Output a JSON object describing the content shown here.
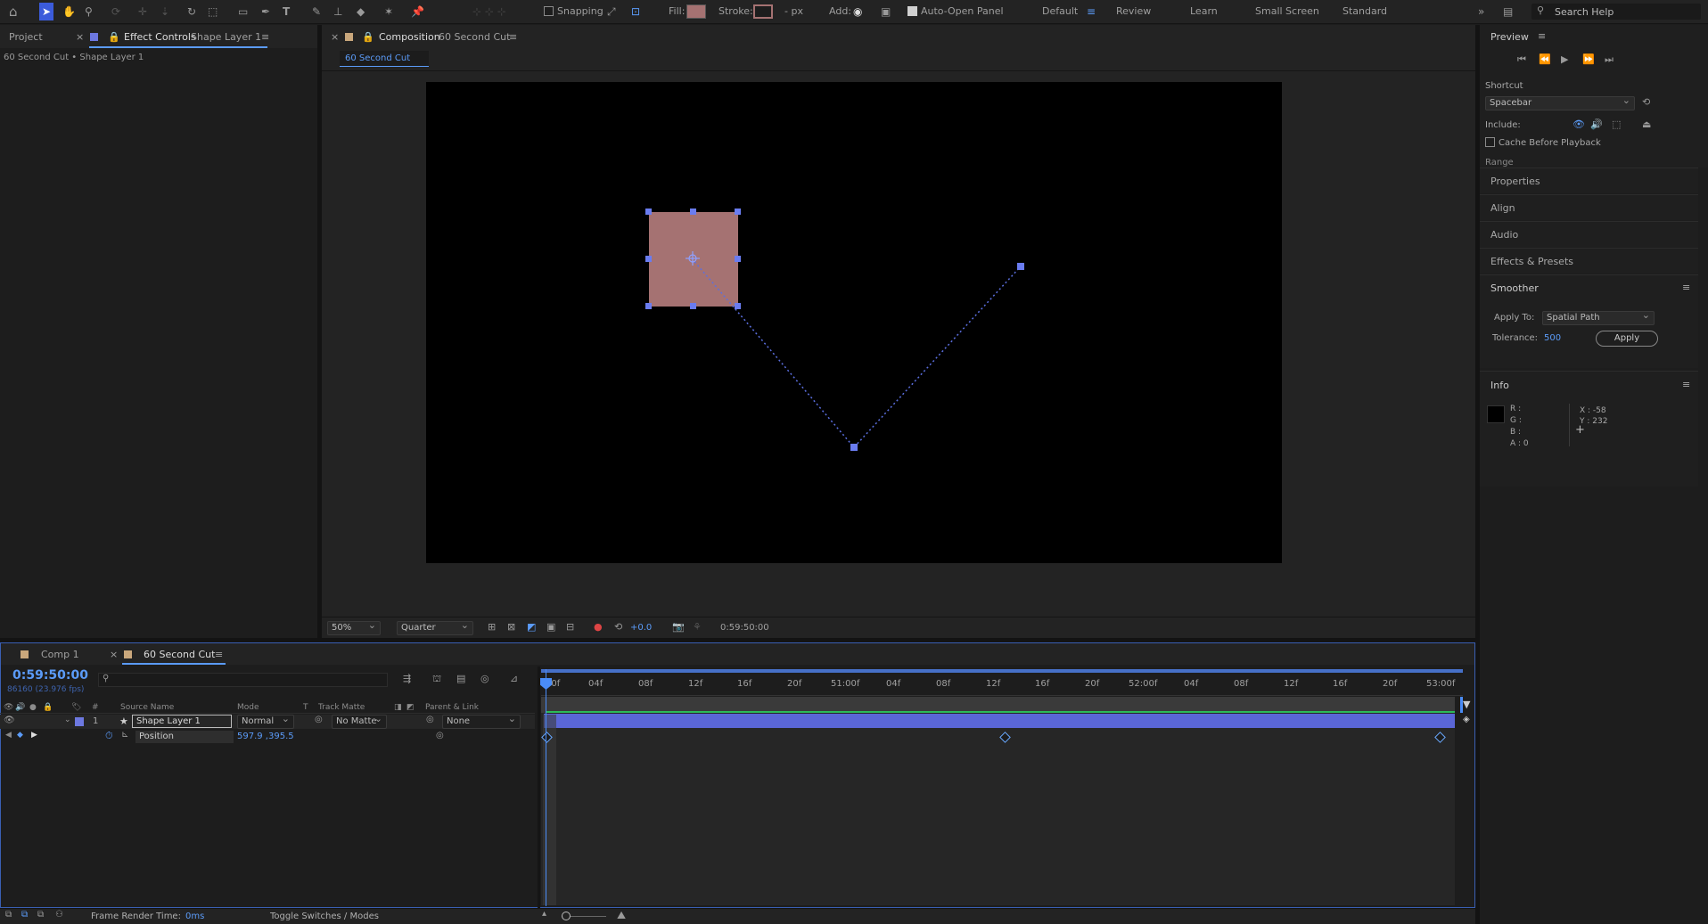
{
  "toolbar": {
    "snapping_label": "Snapping",
    "fill_label": "Fill:",
    "stroke_label": "Stroke:",
    "stroke_px_label": "- px",
    "add_label": "Add:",
    "auto_open_label": "Auto-Open Panel",
    "workspaces": [
      "Default",
      "Review",
      "Learn",
      "Small Screen",
      "Standard"
    ],
    "active_workspace": "Default",
    "search_placeholder": "Search Help",
    "fill_color": "#a57272",
    "accent": "#5b9bf8"
  },
  "left_panel": {
    "tabs": {
      "project": "Project",
      "effect_controls": "Effect Controls",
      "effect_controls_target": "Shape Layer 1"
    },
    "breadcrumb": "60 Second Cut • Shape Layer 1"
  },
  "comp_panel": {
    "tab_label": "Composition",
    "tab_comp_name": "60 Second Cut",
    "subtab": "60 Second Cut",
    "zoom": "50%",
    "resolution": "Quarter",
    "exposure": "+0.0",
    "timecode": "0:59:50:00",
    "shape_fill": "#a57272",
    "path_color": "#5b6fe0"
  },
  "right_panel": {
    "preview_title": "Preview",
    "shortcut_label": "Shortcut",
    "shortcut_value": "Spacebar",
    "include_label": "Include:",
    "cache_label": "Cache Before Playback",
    "range_label": "Range",
    "sections": [
      "Properties",
      "Align",
      "Audio",
      "Effects & Presets"
    ],
    "smoother_title": "Smoother",
    "apply_to_label": "Apply To:",
    "apply_to_value": "Spatial Path",
    "tolerance_label": "Tolerance:",
    "tolerance_value": "500",
    "apply_button": "Apply",
    "info_title": "Info",
    "info_r": "R :",
    "info_g": "G :",
    "info_b": "B :",
    "info_a": "A :  0",
    "info_x": "X : -58",
    "info_y": "Y : 232"
  },
  "timeline": {
    "tabs": [
      "Comp 1",
      "60 Second Cut"
    ],
    "current_time": "0:59:50:00",
    "frame_info": "86160 (23.976 fps)",
    "search_placeholder": "",
    "columns": {
      "source_name": "Source Name",
      "mode": "Mode",
      "t": "T",
      "track_matte": "Track Matte",
      "parent": "Parent & Link"
    },
    "layer": {
      "index": "1",
      "name": "Shape Layer 1",
      "mode": "Normal",
      "matte": "No Matte",
      "parent": "None"
    },
    "property": {
      "name": "Position",
      "value": "597.9 ,395.5"
    },
    "ruler": [
      "00f",
      "04f",
      "08f",
      "12f",
      "16f",
      "20f",
      "51:00f",
      "04f",
      "08f",
      "12f",
      "16f",
      "20f",
      "52:00f",
      "04f",
      "08f",
      "12f",
      "16f",
      "20f",
      "53:00f"
    ],
    "bar_color": "#5a66d6"
  },
  "status_bar": {
    "frame_render_label": "Frame Render Time:",
    "frame_render_value": "0ms",
    "toggle_label": "Toggle Switches / Modes"
  }
}
